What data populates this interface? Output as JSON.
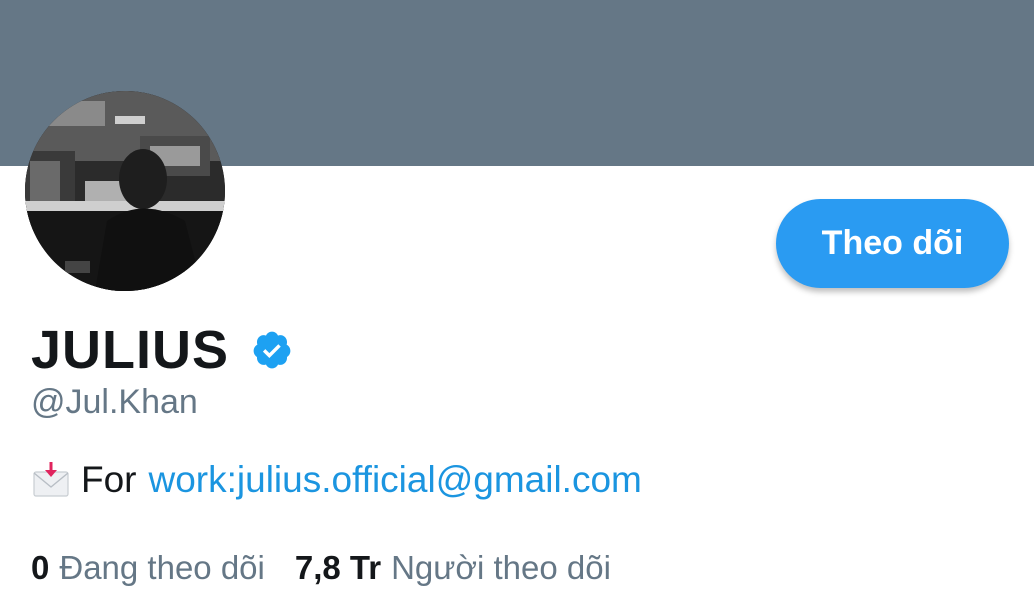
{
  "profile": {
    "display_name": "JULIUS",
    "handle": "@Jul.Khan",
    "verified_icon": "verified-badge-icon",
    "follow_button_label": "Theo dõi",
    "bio": {
      "icon": "envelope-with-arrow-icon",
      "prefix": "For",
      "link_text": "work:julius.official@gmail.com"
    },
    "stats": {
      "following_count": "0",
      "following_label": "Đang theo dõi",
      "followers_count": "7,8 Tr",
      "followers_label": "Người theo dõi"
    }
  },
  "colors": {
    "banner": "#657786",
    "accent": "#2a9bf2",
    "link": "#1b95e0",
    "text_primary": "#14171a",
    "text_secondary": "#657786"
  }
}
